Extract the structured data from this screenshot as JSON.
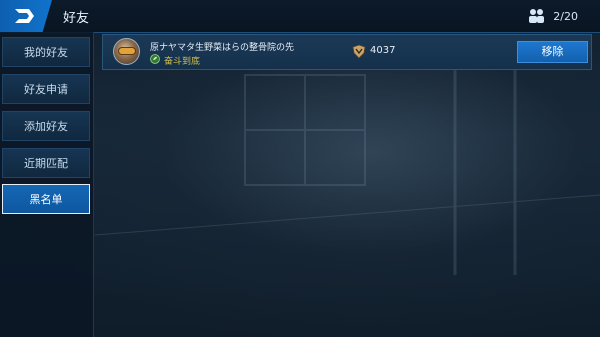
{
  "header": {
    "title": "好友",
    "back_icon": "back-arrow-icon",
    "count_icon": "friends-group-icon",
    "count": "2/20"
  },
  "sidebar": {
    "items": [
      {
        "label": "我的好友",
        "active": false
      },
      {
        "label": "好友申请",
        "active": false
      },
      {
        "label": "添加好友",
        "active": false
      },
      {
        "label": "近期匹配",
        "active": false
      },
      {
        "label": "黑名单",
        "active": true
      }
    ]
  },
  "blacklist": {
    "rows": [
      {
        "name": "原ナヤマタ生野菜はらの整骨院の先",
        "status_icon": "leaf-status-icon",
        "status": "奋斗到底",
        "rank_icon": "rank-shield-icon",
        "rank_value": "4037",
        "action_label": "移除"
      }
    ]
  },
  "colors": {
    "accent": "#1467b5",
    "status_yellow": "#d7c04b"
  }
}
